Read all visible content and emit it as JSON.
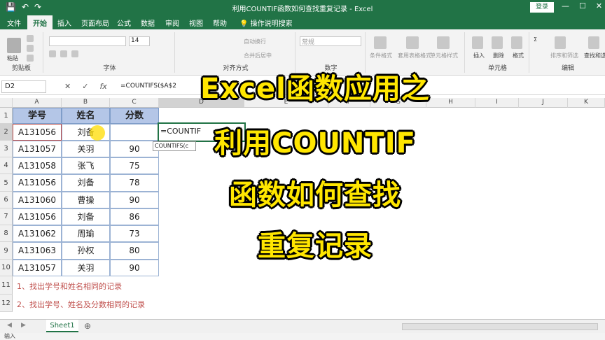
{
  "window": {
    "title": "利用COUNTIF函数如何查找重复记录  -  Excel",
    "login_label": "登录"
  },
  "tabs": [
    "文件",
    "开始",
    "插入",
    "页面布局",
    "公式",
    "数据",
    "审阅",
    "视图",
    "帮助"
  ],
  "tell_me": "操作说明搜索",
  "ribbon": {
    "paste_label": "粘贴",
    "clipboard_label": "剪贴板",
    "font_label": "字体",
    "font_size": "14",
    "align_label": "对齐方式",
    "wrap_label": "自动换行",
    "merge_label": "合并后居中",
    "number_format": "常规",
    "number_label": "数字",
    "cond_format_label": "条件格式",
    "table_format_label": "套用表格格式",
    "cell_style_label": "单元格样式",
    "insert_label": "插入",
    "delete_label": "删除",
    "format_label": "格式",
    "cells_label": "单元格",
    "sort_label": "排序和筛选",
    "find_label": "查找和选择",
    "edit_label": "编辑"
  },
  "formula_bar": {
    "name_box": "D2",
    "cancel": "✕",
    "confirm": "✓",
    "fx": "fx",
    "formula": "=COUNTIFS($A$2"
  },
  "columns": [
    "A",
    "B",
    "C",
    "D",
    "E",
    "F",
    "G",
    "H",
    "I",
    "J",
    "K"
  ],
  "rows": [
    "1",
    "2",
    "3",
    "4",
    "5",
    "6",
    "7",
    "8",
    "9",
    "10",
    "11",
    "12"
  ],
  "table": {
    "headers": [
      "学号",
      "姓名",
      "分数"
    ],
    "data": [
      [
        "A131056",
        "刘备",
        ""
      ],
      [
        "A131057",
        "关羽",
        "90"
      ],
      [
        "A131058",
        "张飞",
        "75"
      ],
      [
        "A131056",
        "刘备",
        "78"
      ],
      [
        "A131060",
        "曹操",
        "90"
      ],
      [
        "A131056",
        "刘备",
        "86"
      ],
      [
        "A131062",
        "周瑜",
        "73"
      ],
      [
        "A131063",
        "孙权",
        "80"
      ],
      [
        "A131057",
        "关羽",
        "90"
      ]
    ]
  },
  "editing_cell": "=COUNTIF",
  "tooltip": "COUNTIFS(c",
  "notes": [
    "1、找出学号和姓名相同的记录",
    "2、找出学号、姓名及分数相同的记录"
  ],
  "overlay": [
    "Excel函数应用之",
    "利用COUNTIF",
    "函数如何查找",
    "重复记录"
  ],
  "sheet": {
    "name": "Sheet1",
    "add": "⊕"
  },
  "status": "输入",
  "colors": {
    "excel_green": "#217346",
    "overlay_yellow": "#ffe600",
    "header_fill": "#b4c6e7",
    "note_red": "#c0504d"
  }
}
